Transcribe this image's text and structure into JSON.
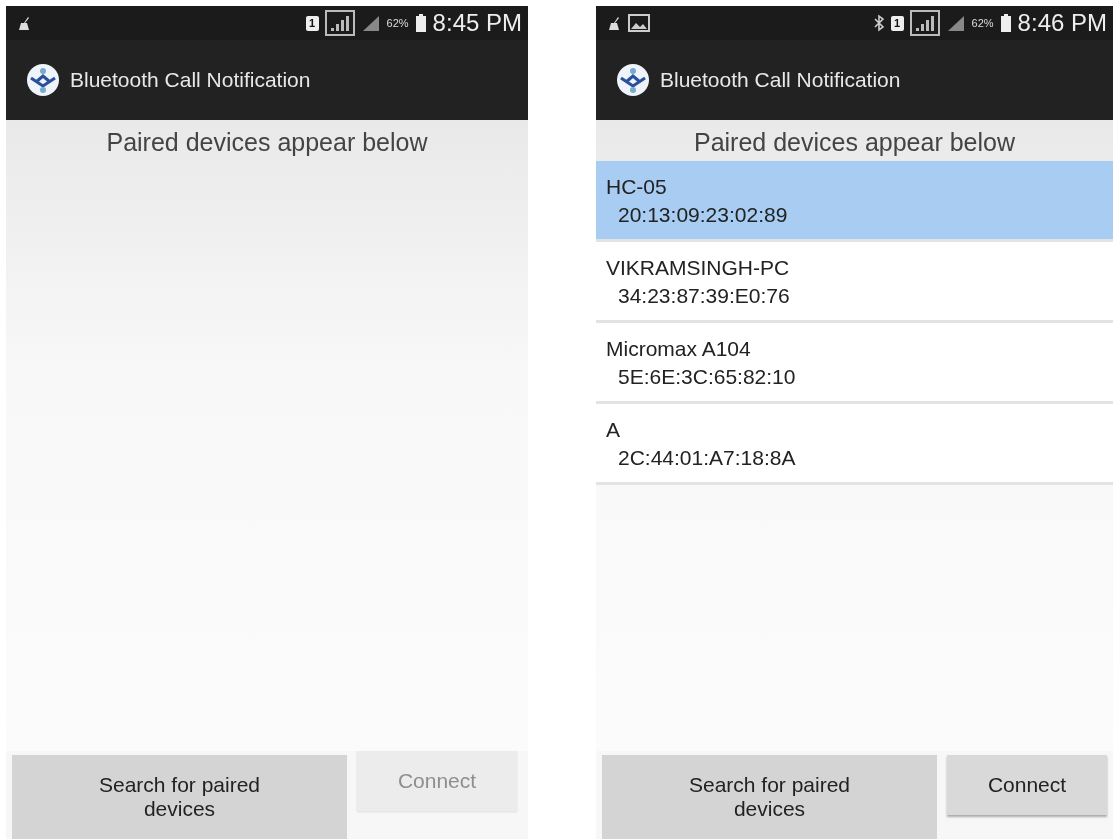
{
  "screens": [
    {
      "status_bar": {
        "icons": [
          {
            "kind": "cleaner"
          }
        ],
        "sim": "1",
        "battery": "62%",
        "time": "8:45 PM"
      },
      "app_bar": {
        "title": "Bluetooth Call Notification"
      },
      "header": "Paired devices appear below",
      "buttons": [
        {
          "label": "Search for paired devices",
          "disabled": false,
          "kind": "wide"
        },
        {
          "label": "Connect",
          "disabled": true,
          "kind": "narrow"
        }
      ]
    },
    {
      "status_bar": {
        "icons": [
          {
            "kind": "cleaner"
          },
          {
            "kind": "image"
          }
        ],
        "right_icons": [
          {
            "kind": "bluetooth"
          }
        ],
        "sim": "1",
        "battery": "62%",
        "time": "8:46 PM"
      },
      "app_bar": {
        "title": "Bluetooth Call Notification"
      },
      "header": "Paired devices appear below",
      "devices": [
        {
          "name": "HC-05",
          "address": "20:13:09:23:02:89",
          "selected": true
        },
        {
          "name": "VIKRAMSINGH-PC",
          "address": "34:23:87:39:E0:76",
          "selected": false
        },
        {
          "name": "Micromax A104",
          "address": "5E:6E:3C:65:82:10",
          "selected": false
        },
        {
          "name": "A",
          "address": "2C:44:01:A7:18:8A",
          "selected": false
        }
      ],
      "buttons": [
        {
          "label": "Search for paired devices",
          "disabled": false,
          "kind": "wide"
        },
        {
          "label": "Connect",
          "disabled": false,
          "kind": "narrow"
        }
      ]
    }
  ]
}
